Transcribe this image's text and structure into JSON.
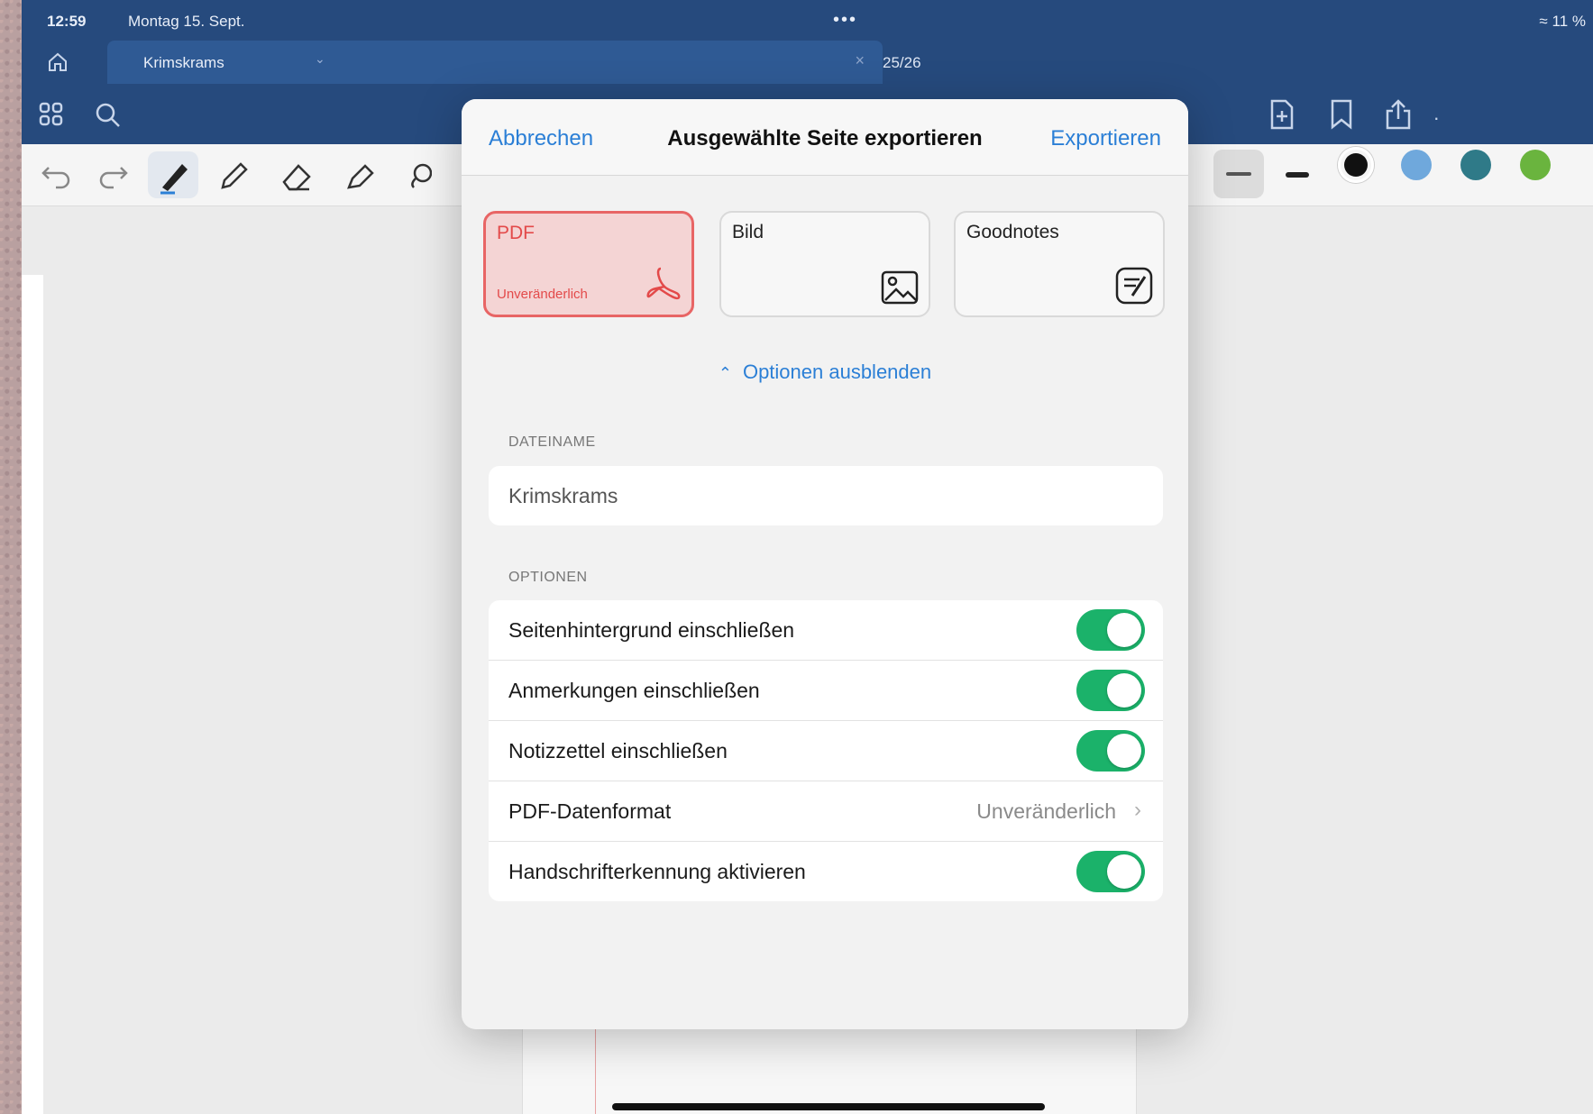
{
  "status_bar": {
    "time": "12:59",
    "date": "Montag 15. Sept.",
    "dots": "•••",
    "battery": "11 %"
  },
  "tab": {
    "document_name": "Krimskrams",
    "page_count": "25/26"
  },
  "toolbar_colors": [
    "#111111",
    "#6fa8dc",
    "#2f7a88",
    "#6ab43e"
  ],
  "dialog": {
    "cancel_label": "Abbrechen",
    "title": "Ausgewählte Seite exportieren",
    "export_label": "Exportieren",
    "formats": [
      {
        "name": "PDF",
        "subtitle": "Unveränderlich",
        "icon": "pdf-icon",
        "selected": true
      },
      {
        "name": "Bild",
        "subtitle": "",
        "icon": "image-icon",
        "selected": false
      },
      {
        "name": "Goodnotes",
        "subtitle": "",
        "icon": "goodnotes-icon",
        "selected": false
      }
    ],
    "options_toggle_label": "Optionen ausblenden",
    "filename_section": "DATEINAME",
    "filename_value": "Krimskrams",
    "options_section": "OPTIONEN",
    "options": [
      {
        "label": "Seitenhintergrund einschließen",
        "type": "toggle",
        "on": true
      },
      {
        "label": "Anmerkungen einschließen",
        "type": "toggle",
        "on": true
      },
      {
        "label": "Notizzettel einschließen",
        "type": "toggle",
        "on": true
      },
      {
        "label": "PDF-Datenformat",
        "type": "value",
        "value": "Unveränderlich"
      },
      {
        "label": "Handschrifterkennung aktivieren",
        "type": "toggle",
        "on": true
      }
    ],
    "accent_color": "#2b7fd6",
    "toggle_color": "#1bb26a",
    "selected_color": "#e86565"
  }
}
